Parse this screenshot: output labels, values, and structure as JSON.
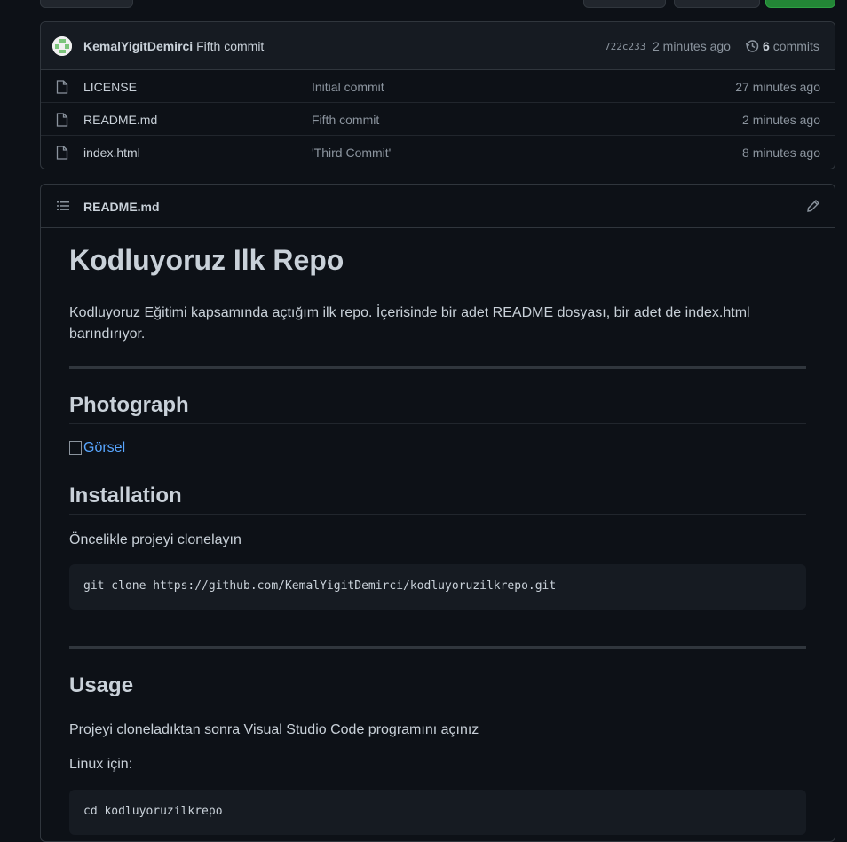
{
  "latest_commit": {
    "author": "KemalYigitDemirci",
    "message": "Fifth commit",
    "sha": "722c233",
    "time": "2 minutes ago",
    "commits_count": "6",
    "commits_label": "commits"
  },
  "files": [
    {
      "name": "LICENSE",
      "message": "Initial commit",
      "time": "27 minutes ago"
    },
    {
      "name": "README.md",
      "message": "Fifth commit",
      "time": "2 minutes ago"
    },
    {
      "name": "index.html",
      "message": "'Third Commit'",
      "time": "8 minutes ago"
    }
  ],
  "readme": {
    "filename": "README.md",
    "h1": "Kodluyoruz Ilk Repo",
    "intro": "Kodluyoruz Eğitimi kapsamında açtığım ilk repo. İçerisinde bir adet README dosyası, bir adet de index.html barındırıyor.",
    "photo_heading": "Photograph",
    "image_alt": "Görsel",
    "install_heading": "Installation",
    "install_text": "Öncelikle projeyi clonelayın",
    "install_code": "git clone https://github.com/KemalYigitDemirci/kodluyoruzilkrepo.git",
    "usage_heading": "Usage",
    "usage_text": "Projeyi cloneladıktan sonra Visual Studio Code programını açınız",
    "linux_text": "Linux için:",
    "linux_code": "cd kodluyoruzilkrepo"
  },
  "colors": {
    "background": "#0d1117",
    "link": "#58a6ff",
    "button_green": "#238636"
  }
}
